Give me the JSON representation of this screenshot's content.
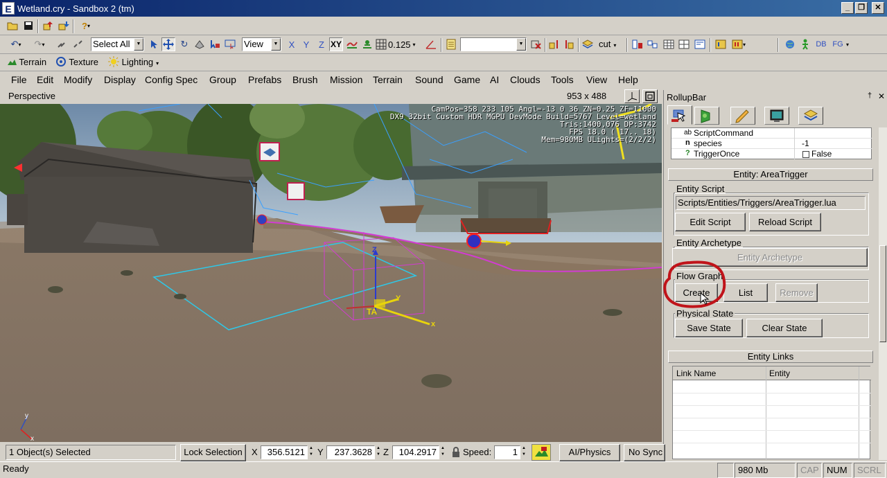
{
  "window": {
    "title": "Wetland.cry - Sandbox 2 (tm)",
    "app_icon": "E",
    "minimize": "_",
    "restore": "❐",
    "close": "✕"
  },
  "toolbar2": {
    "select_combo": "Select All",
    "view_combo": "View",
    "axis_x": "X",
    "axis_y": "Y",
    "axis_z": "Z",
    "axis_xy": "XY",
    "grid_value": "0.125",
    "layer_label": "cut",
    "db_label": "DB",
    "fg_label": "FG"
  },
  "toolbar3": {
    "terrain": "Terrain",
    "texture": "Texture",
    "lighting": "Lighting"
  },
  "menu": [
    "File",
    "Edit",
    "Modify",
    "Display",
    "Config Spec",
    "Group",
    "Prefabs",
    "Brush",
    "Mission",
    "Terrain",
    "Sound",
    "Game",
    "AI",
    "Clouds",
    "Tools",
    "View",
    "Help"
  ],
  "viewport": {
    "name": "Perspective",
    "resolution": "953 x 488",
    "overlay": [
      "CamPos=358 233 105 Angl=-13  0  36 ZN=0.25 ZF=11000",
      "DX9 32bit Custom HDR MGPU DevMode Build=5767 Level=wetland",
      "Tris:1400,076  DP:3742",
      "FPS 18.0 ( 17.. 18)",
      "Mem=980MB ULights=(2/2/2)"
    ],
    "gizmo_labels": {
      "z": "Z",
      "y": "Y",
      "x": "x",
      "ta": "TA"
    },
    "corner_axis": {
      "y": "y",
      "x": "x"
    }
  },
  "rollup": {
    "title": "RollupBar",
    "pin": "†",
    "close": "✕",
    "tabs": [
      "objects-tab",
      "terrain-tab",
      "modify-tab",
      "display-tab",
      "layers-tab"
    ],
    "properties": [
      {
        "type": "ab",
        "name": "ScriptCommand",
        "value": ""
      },
      {
        "type": "n",
        "name": "species",
        "value": "-1"
      },
      {
        "type": "?",
        "name": "TriggerOnce",
        "value": "False"
      }
    ],
    "entity_header": "Entity: AreaTrigger",
    "entity_script_label": "Entity Script",
    "script_path": "Scripts/Entities/Triggers/AreaTrigger.lua",
    "edit_script": "Edit Script",
    "reload_script": "Reload Script",
    "archetype_label": "Entity Archetype",
    "archetype_button": "Entity Archetype",
    "flowgraph_label": "Flow Graph",
    "create": "Create",
    "list": "List",
    "remove": "Remove",
    "physical_label": "Physical State",
    "save_state": "Save State",
    "clear_state": "Clear State",
    "links_header": "Entity Links",
    "links_columns": [
      "Link Name",
      "Entity"
    ]
  },
  "statusbar": {
    "selected": "1 Object(s) Selected",
    "lock": "Lock Selection",
    "x_label": "X",
    "x": "356.5121",
    "y_label": "Y",
    "y": "237.3628",
    "z_label": "Z",
    "z": "104.2917",
    "speed_label": "Speed:",
    "speed": "1",
    "ai_physics": "AI/Physics",
    "no_sync": "No Sync",
    "ready": "Ready",
    "memory": "980 Mb",
    "cap": "CAP",
    "num": "NUM",
    "scrl": "SCRL"
  },
  "colors": {
    "title_start": "#0a246a",
    "title_end": "#3a6ea5",
    "annotation": "#c0141a",
    "selection_magenta": "#d23cd2",
    "gizmo_yellow": "#e8d40c"
  }
}
